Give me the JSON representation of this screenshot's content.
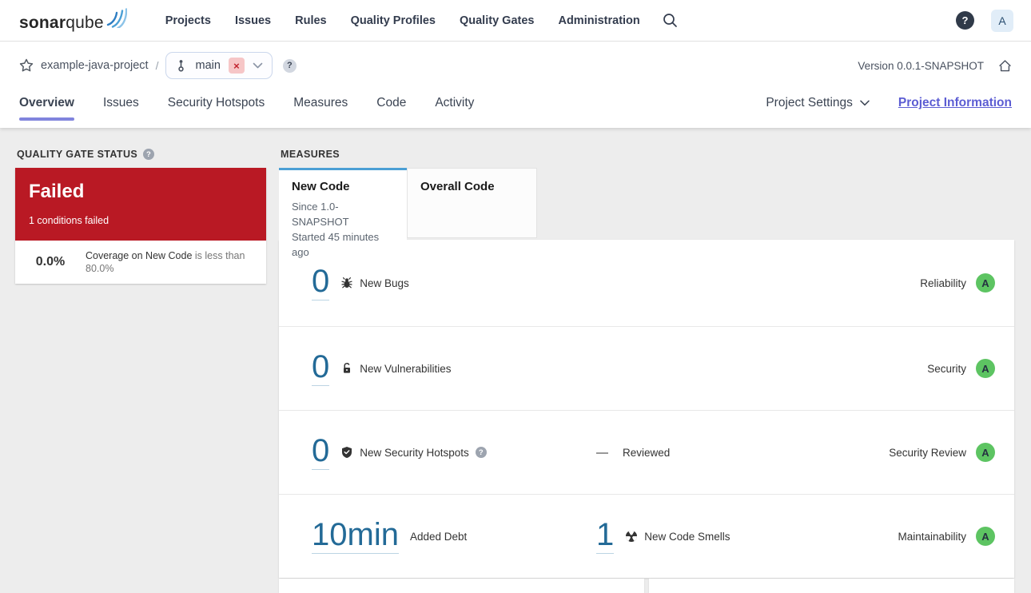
{
  "topnav": {
    "logo_bold": "sonar",
    "logo_light": "qube",
    "items": [
      {
        "label": "Projects"
      },
      {
        "label": "Issues"
      },
      {
        "label": "Rules"
      },
      {
        "label": "Quality Profiles"
      },
      {
        "label": "Quality Gates"
      },
      {
        "label": "Administration"
      }
    ],
    "help_glyph": "?",
    "avatar": "A"
  },
  "breadcrumb": {
    "project": "example-java-project",
    "separator": "/",
    "branch": "main",
    "close_glyph": "×",
    "help_glyph": "?",
    "version": "Version 0.0.1-SNAPSHOT"
  },
  "tabs": {
    "active": "Overview",
    "items": [
      {
        "label": "Overview"
      },
      {
        "label": "Issues"
      },
      {
        "label": "Security Hotspots"
      },
      {
        "label": "Measures"
      },
      {
        "label": "Code"
      },
      {
        "label": "Activity"
      }
    ],
    "project_settings": "Project Settings",
    "project_information": "Project Information"
  },
  "quality_gate": {
    "title": "QUALITY GATE STATUS",
    "help_glyph": "?",
    "status": "Failed",
    "conditions_text": "1 conditions failed",
    "condition": {
      "value": "0.0%",
      "metric": "Coverage on New Code",
      "comparison": "is less than 80.0%"
    }
  },
  "measures": {
    "title": "MEASURES",
    "new_code_tab": {
      "label": "New Code",
      "since": "Since 1.0-SNAPSHOT",
      "started": "Started 45 minutes ago"
    },
    "overall_code_tab": {
      "label": "Overall Code"
    },
    "rows": [
      {
        "value": "0",
        "icon": "bug-icon",
        "label": "New Bugs",
        "rating_label": "Reliability",
        "rating": "A"
      },
      {
        "value": "0",
        "icon": "lock-icon",
        "label": "New Vulnerabilities",
        "rating_label": "Security",
        "rating": "A"
      },
      {
        "value": "0",
        "icon": "shield-icon",
        "label": "New Security Hotspots",
        "help_glyph": "?",
        "reviewed_dash": "—",
        "reviewed_label": "Reviewed",
        "rating_label": "Security Review",
        "rating": "A"
      },
      {
        "value": "10min",
        "label": "Added Debt",
        "value2": "1",
        "icon2": "code-smell-icon",
        "label2": "New Code Smells",
        "rating_label": "Maintainability",
        "rating": "A"
      }
    ]
  },
  "colors": {
    "failed_red": "#b91924",
    "rating_a_green": "#5dc462",
    "metric_link_blue": "#236a97",
    "new_code_tab_blue": "#4b9fd5",
    "active_tab_underline": "#8084dd",
    "project_information_link": "#5c5dd3"
  }
}
